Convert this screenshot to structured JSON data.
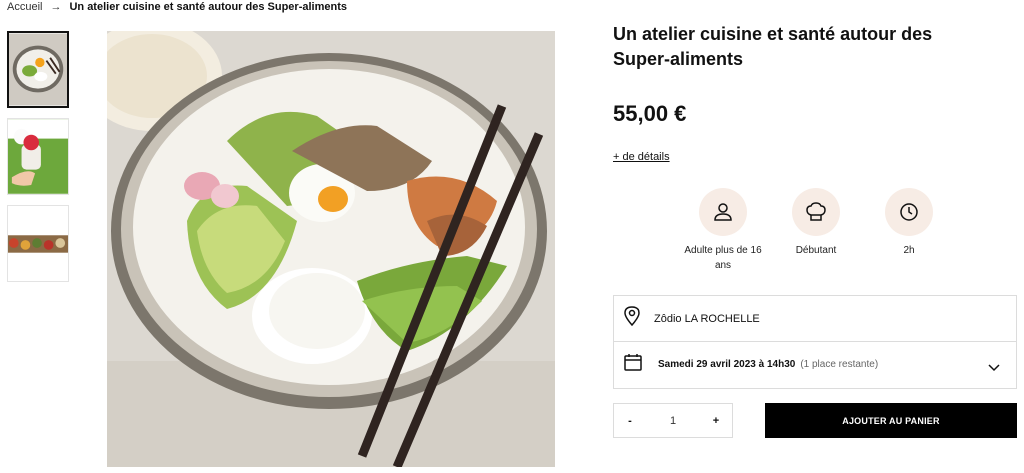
{
  "breadcrumb": {
    "home": "Accueil",
    "separator": "→",
    "current": "Un atelier cuisine et santé autour des Super-aliments"
  },
  "product": {
    "title": "Un atelier cuisine et santé autour des Super-aliments",
    "price": "55,00 €",
    "details_link": "+ de détails"
  },
  "features": [
    {
      "icon": "user-icon",
      "label": "Adulte plus de 16 ans"
    },
    {
      "icon": "chef-hat-icon",
      "label": "Débutant"
    },
    {
      "icon": "clock-icon",
      "label": "2h"
    }
  ],
  "location": {
    "icon": "map-pin-icon",
    "label": "Zôdio LA ROCHELLE"
  },
  "session": {
    "icon": "calendar-icon",
    "date": "Samedi 29 avril 2023 à 14h30",
    "availability": "(1 place restante)"
  },
  "quantity": {
    "minus": "-",
    "value": "1",
    "plus": "+"
  },
  "cart": {
    "label": "AJOUTER AU PANIER"
  },
  "colors": {
    "feature_bg": "#f7ece5",
    "button_bg": "#000000",
    "border": "#dcdcdc"
  }
}
